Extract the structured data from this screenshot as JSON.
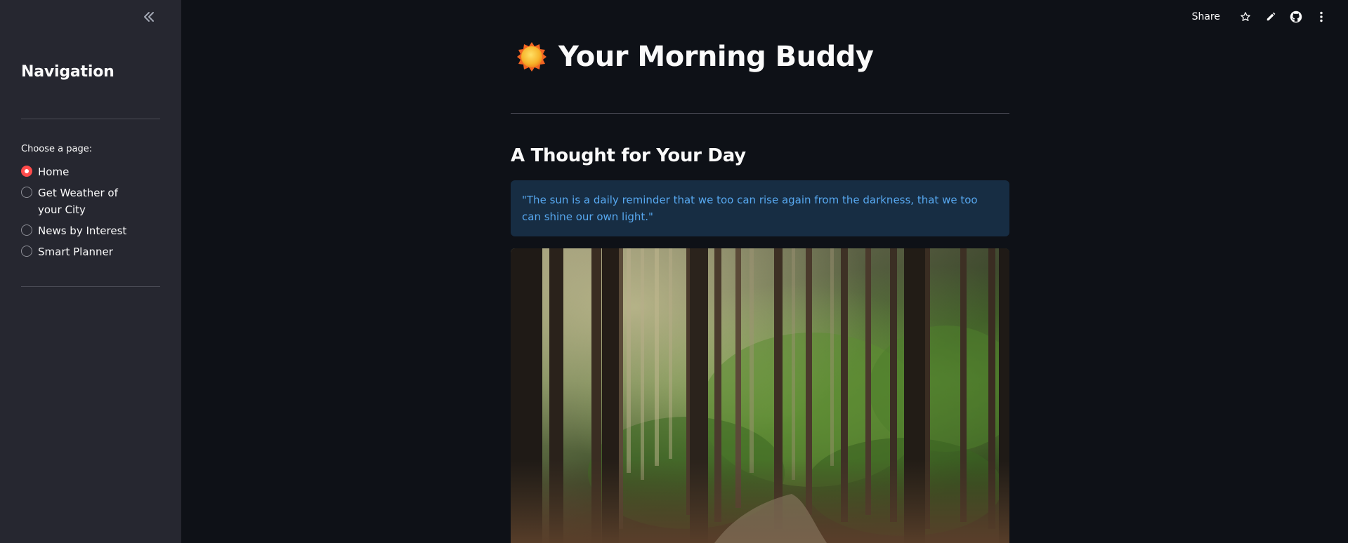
{
  "sidebar": {
    "collapse_icon": "double-chevron-left-icon",
    "title": "Navigation",
    "radio_label": "Choose a page:",
    "options": [
      {
        "label": "Home",
        "selected": true
      },
      {
        "label": "Get Weather of your City",
        "selected": false
      },
      {
        "label": "News by Interest",
        "selected": false
      },
      {
        "label": "Smart Planner",
        "selected": false
      }
    ]
  },
  "toolbar": {
    "share_label": "Share",
    "icons": [
      "star-icon",
      "pencil-icon",
      "github-icon",
      "more-vertical-icon"
    ]
  },
  "main": {
    "title_icon": "sun-icon",
    "title": "Your Morning Buddy",
    "section_heading": "A Thought for Your Day",
    "quote": "\"The sun is a daily reminder that we too can rise again from the darkness, that we too can shine our own light.\"",
    "image_subject": "forest-path-image"
  },
  "colors": {
    "background": "#0e1117",
    "sidebar": "#262730",
    "accent": "#ff4b4b",
    "info_bg": "#172d43",
    "info_text": "#57a8f0"
  }
}
